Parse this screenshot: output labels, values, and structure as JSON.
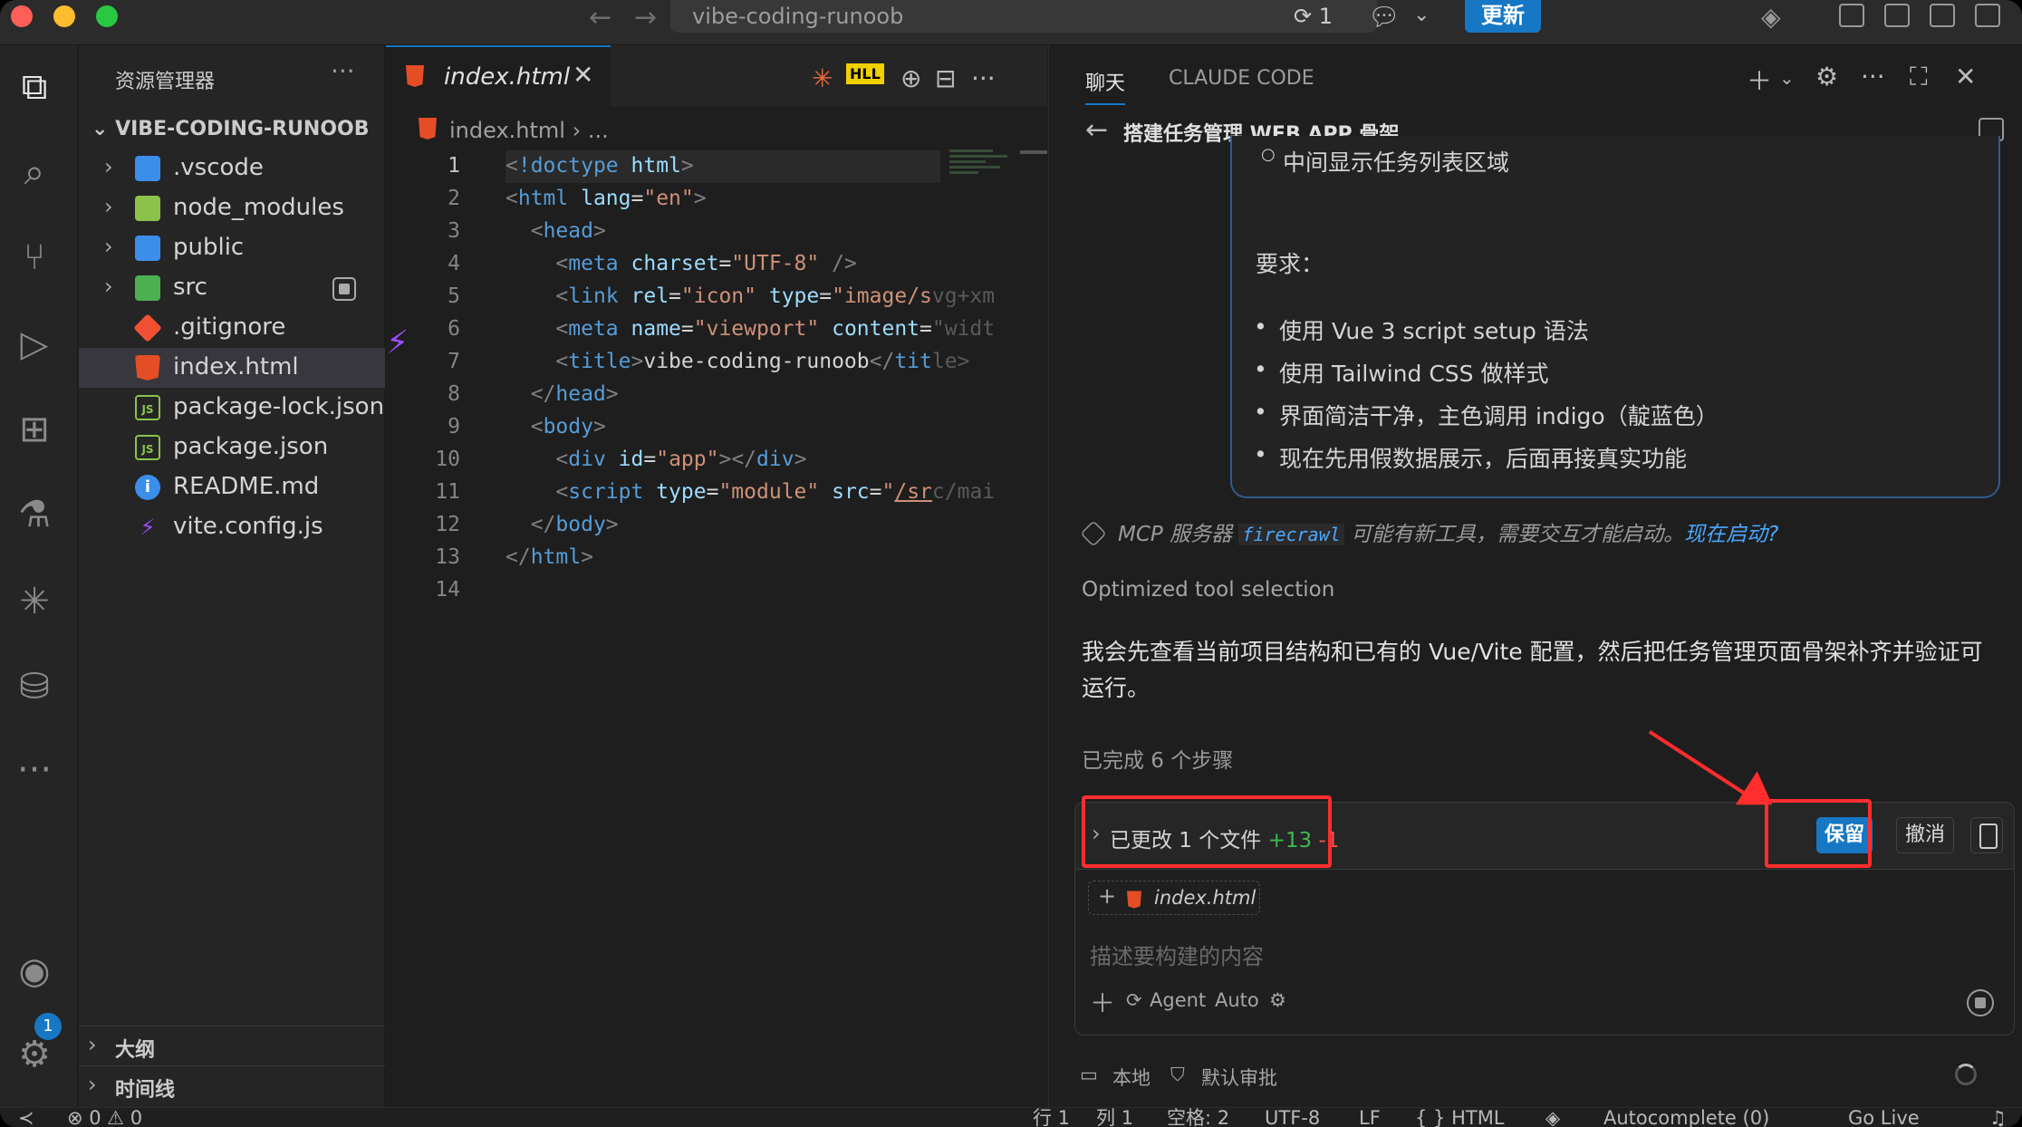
{
  "titlebar": {
    "search_text": "vibe-coding-runoob",
    "sync_count": "1",
    "update_label": "更新"
  },
  "activity": {
    "settings_badge": "1"
  },
  "explorer": {
    "title": "资源管理器",
    "more": "···",
    "root": "VIBE-CODING-RUNOOB",
    "items": [
      {
        "label": ".vscode",
        "icon": "vscode-folder-icon",
        "color": "#3b8eea"
      },
      {
        "label": "node_modules",
        "icon": "node-folder-icon",
        "color": "#8bc34a"
      },
      {
        "label": "public",
        "icon": "public-folder-icon",
        "color": "#3b8eea"
      },
      {
        "label": "src",
        "icon": "src-folder-icon",
        "color": "#4caf50"
      },
      {
        "label": ".gitignore",
        "icon": "git-icon",
        "color": "#f05133"
      },
      {
        "label": "index.html",
        "icon": "html5-icon",
        "color": "#e44d26"
      },
      {
        "label": "package-lock.json",
        "icon": "nodejs-icon",
        "color": "#8bc34a"
      },
      {
        "label": "package.json",
        "icon": "nodejs-icon",
        "color": "#8bc34a"
      },
      {
        "label": "README.md",
        "icon": "info-icon",
        "color": "#3b8eea"
      },
      {
        "label": "vite.config.js",
        "icon": "vite-icon",
        "color": "#9b4dff"
      }
    ],
    "sections": [
      "大纲",
      "时间线"
    ]
  },
  "editor": {
    "tab_label": "index.html",
    "breadcrumb_file": "index.html",
    "breadcrumb_rest": "...",
    "line_numbers": [
      "1",
      "2",
      "3",
      "4",
      "5",
      "6",
      "7",
      "8",
      "9",
      "10",
      "11",
      "12",
      "13",
      "14"
    ]
  },
  "chat": {
    "tabs": [
      "聊天",
      "CLAUDE CODE"
    ],
    "title": "搭建任务管理 WEB APP 骨架",
    "bubble_sub": "中间显示任务列表区域",
    "bubble_req": "要求：",
    "bubble_items": [
      "使用 Vue 3 script setup 语法",
      "使用 Tailwind CSS 做样式",
      "界面简洁干净，主色调用 indigo（靛蓝色）",
      "现在先用假数据展示，后面再接真实功能"
    ],
    "mcp_prefix": "MCP 服务器",
    "mcp_server": "firecrawl",
    "mcp_text": "可能有新工具，需要交互才能启动。",
    "mcp_link": "现在启动?",
    "optimized": "Optimized tool selection",
    "paragraph": "我会先查看当前项目结构和已有的 Vue/Vite 配置，然后把任务管理页面骨架补齐并验证可运行。",
    "steps": "已完成 6 个步骤",
    "changes_label": "已更改 1 个文件",
    "changes_add": "+13",
    "changes_del": "-1",
    "keep_label": "保留",
    "undo_label": "撤消",
    "file_chip": "index.html",
    "prompt_placeholder": "描述要构建的内容",
    "mode_agent": "Agent",
    "mode_auto": "Auto",
    "footer_local": "本地",
    "footer_approval": "默认审批"
  },
  "statusbar": {
    "errors": "⊗ 0 ⚠ 0",
    "line": "行 1",
    "col": "列 1",
    "spaces": "空格: 2",
    "encoding": "UTF-8",
    "eol": "LF",
    "lang": "{ } HTML",
    "autocomplete": "Autocomplete (0)",
    "golive": "Go Live"
  },
  "colors": {
    "accent": "#1677c4",
    "annotation_red": "#ff2d2d",
    "diff_add": "#3fb950",
    "diff_del": "#f85149"
  }
}
